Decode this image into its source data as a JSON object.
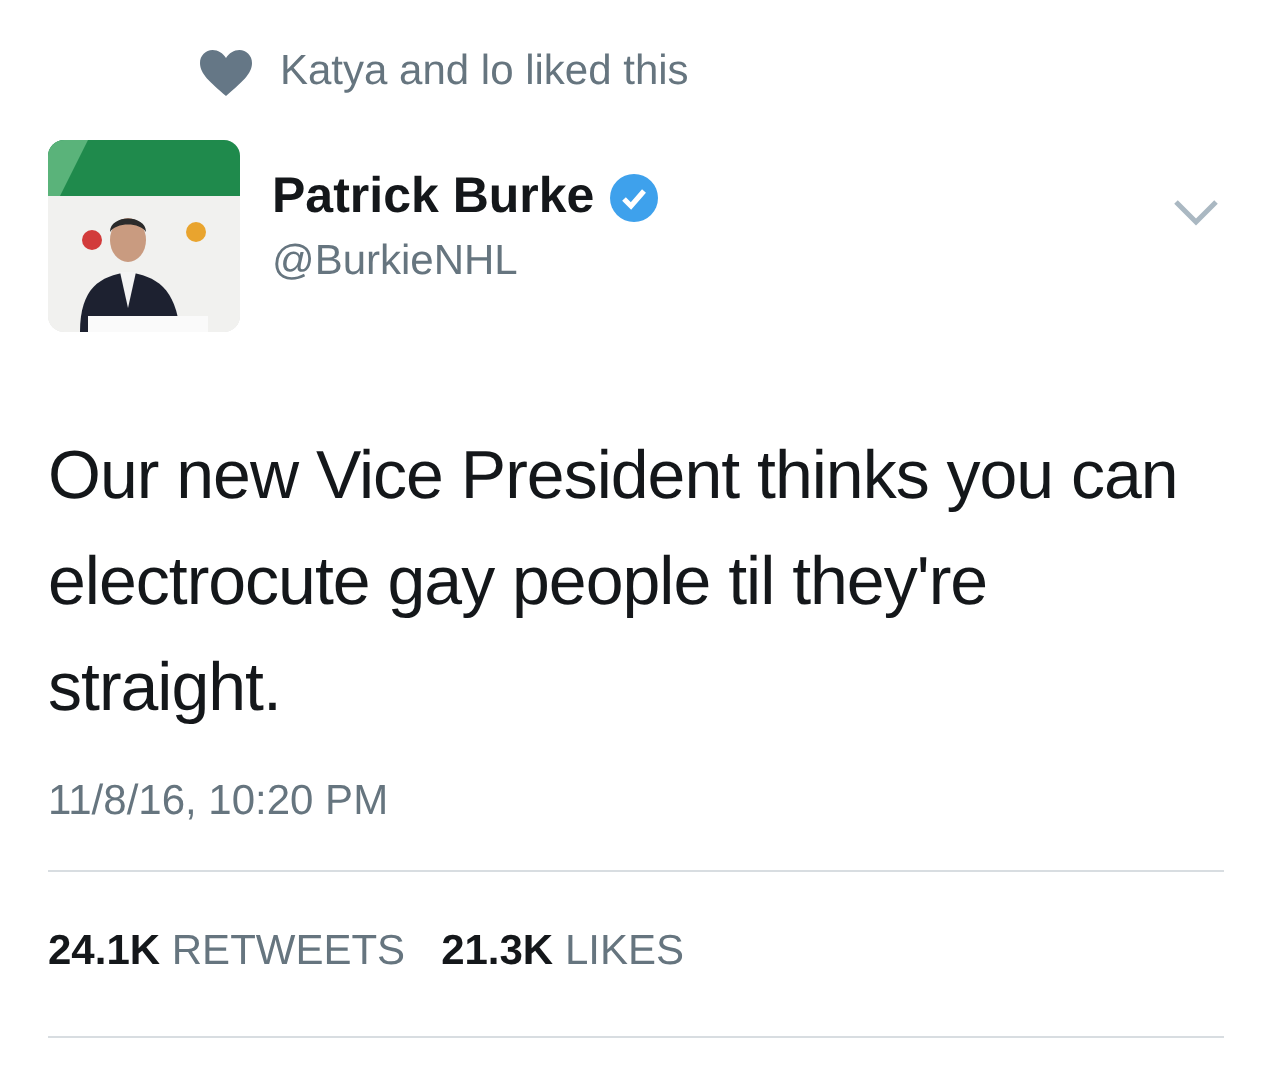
{
  "social_context": {
    "text": "Katya and lo liked this"
  },
  "author": {
    "name": "Patrick Burke",
    "verified": true,
    "handle": "@BurkieNHL"
  },
  "tweet": {
    "text": "Our new Vice President thinks you can electrocute gay people til they're straight.",
    "timestamp": "11/8/16, 10:20 PM"
  },
  "stats": [
    {
      "count": "24.1K",
      "label": "RETWEETS"
    },
    {
      "count": "21.3K",
      "label": "LIKES"
    }
  ]
}
